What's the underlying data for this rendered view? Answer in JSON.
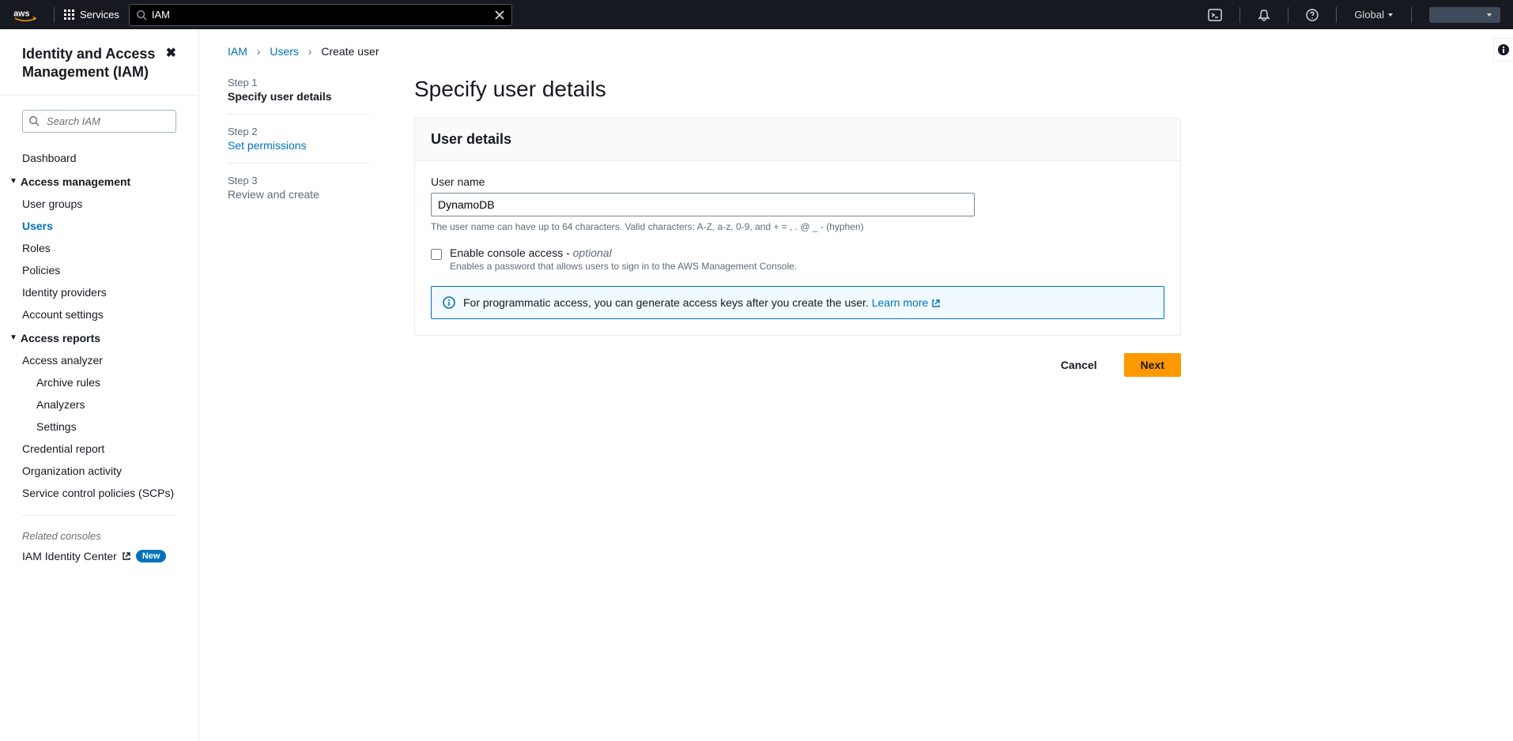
{
  "topnav": {
    "services_label": "Services",
    "search_value": "IAM",
    "region": "Global"
  },
  "sidebar": {
    "title": "Identity and Access Management (IAM)",
    "search_placeholder": "Search IAM",
    "dashboard": "Dashboard",
    "section_access_mgmt": "Access management",
    "items_access": [
      "User groups",
      "Users",
      "Roles",
      "Policies",
      "Identity providers",
      "Account settings"
    ],
    "section_access_reports": "Access reports",
    "items_reports_top": "Access analyzer",
    "items_reports_sub": [
      "Archive rules",
      "Analyzers",
      "Settings"
    ],
    "items_reports_rest": [
      "Credential report",
      "Organization activity",
      "Service control policies (SCPs)"
    ],
    "related_label": "Related consoles",
    "identity_center": "IAM Identity Center",
    "new_badge": "New"
  },
  "breadcrumb": {
    "iam": "IAM",
    "users": "Users",
    "current": "Create user"
  },
  "wizard": {
    "steps": [
      {
        "num": "Step 1",
        "title": "Specify user details"
      },
      {
        "num": "Step 2",
        "title": "Set permissions"
      },
      {
        "num": "Step 3",
        "title": "Review and create"
      }
    ],
    "page_title": "Specify user details",
    "panel_title": "User details",
    "username_label": "User name",
    "username_value": "DynamoDB",
    "username_hint": "The user name can have up to 64 characters. Valid characters: A-Z, a-z, 0-9, and + = , . @ _ - (hyphen)",
    "console_access_label": "Enable console access - ",
    "console_access_optional": "optional",
    "console_access_desc": "Enables a password that allows users to sign in to the AWS Management Console.",
    "info_text": "For programmatic access, you can generate access keys after you create the user. ",
    "info_link": "Learn more",
    "cancel": "Cancel",
    "next": "Next"
  }
}
